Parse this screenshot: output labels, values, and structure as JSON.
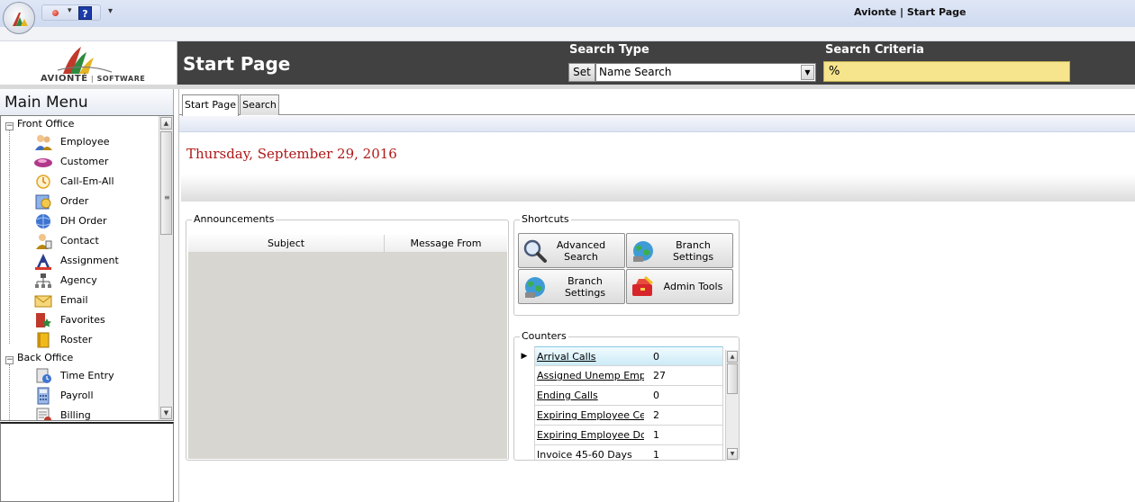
{
  "window": {
    "title": "Avionte | Start Page"
  },
  "quick_access": {
    "help_label": "?",
    "dropdown_glyph": "▾",
    "more_glyph": "▾"
  },
  "logo": {
    "company": "AVIONTÉ",
    "subtitle": "SOFTWARE"
  },
  "header": {
    "page_title": "Start Page",
    "search_type_label": "Search Type",
    "search_criteria_label": "Search Criteria",
    "set_label": "Set",
    "search_type_value": "Name Search",
    "search_criteria_value": "%"
  },
  "menu": {
    "title": "Main Menu",
    "groups": [
      {
        "label": "Front Office",
        "items": [
          "Employee",
          "Customer",
          "Call-Em-All",
          "Order",
          "DH Order",
          "Contact",
          "Assignment",
          "Agency",
          "Email",
          "Favorites",
          "Roster"
        ]
      },
      {
        "label": "Back Office",
        "items": [
          "Time Entry",
          "Payroll",
          "Billing"
        ]
      }
    ]
  },
  "tabs": [
    {
      "label": "Start Page",
      "active": true
    },
    {
      "label": "Search",
      "active": false
    }
  ],
  "start": {
    "date": "Thursday, September 29, 2016"
  },
  "announcements": {
    "title": "Announcements",
    "columns": [
      "Subject",
      "Message From"
    ]
  },
  "shortcuts": {
    "title": "Shortcuts",
    "buttons": [
      {
        "label": "Advanced Search",
        "icon": "magnifier-icon"
      },
      {
        "label": "Branch Settings",
        "icon": "globe-icon"
      },
      {
        "label": "Branch Settings",
        "icon": "globe-icon"
      },
      {
        "label": "Admin Tools",
        "icon": "toolbox-icon"
      }
    ]
  },
  "counters": {
    "title": "Counters",
    "rows": [
      {
        "name": "Arrival Calls",
        "value": "0"
      },
      {
        "name": "Assigned Unemp Emplo",
        "value": "27"
      },
      {
        "name": "Ending Calls",
        "value": "0"
      },
      {
        "name": "Expiring Employee Cert.",
        "value": "2"
      },
      {
        "name": "Expiring Employee Docs",
        "value": "1"
      },
      {
        "name": "Invoice 45-60 Days",
        "value": "1"
      }
    ]
  },
  "colors": {
    "header_bg": "#414141",
    "criteria_bg": "#f6e58d",
    "date_red": "#b01818"
  }
}
